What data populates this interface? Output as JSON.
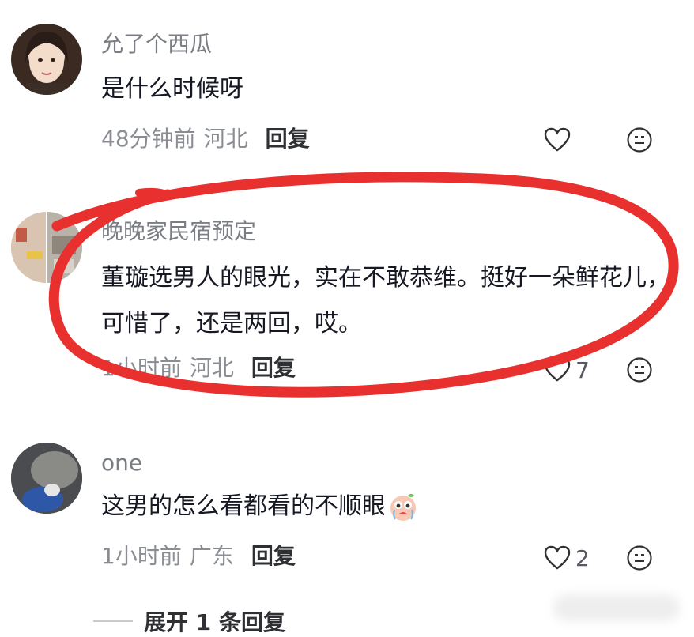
{
  "comments": [
    {
      "username": "允了个西瓜",
      "text": "是什么时候呀",
      "time": "48分钟前",
      "location": "河北",
      "reply_label": "回复",
      "like_count": ""
    },
    {
      "username": "晚晚家民宿预定",
      "text": "董璇选男人的眼光，实在不敢恭维。挺好一朵鲜花儿，可惜了，还是两回，哎。",
      "time": "1小时前",
      "location": "河北",
      "reply_label": "回复",
      "like_count": "7"
    },
    {
      "username": "one",
      "text": "这男的怎么看都看的不顺眼",
      "time": "1小时前",
      "location": "广东",
      "reply_label": "回复",
      "like_count": "2"
    }
  ],
  "expand": {
    "label": "展开 1 条回复"
  },
  "colors": {
    "annotation": "#e8302f",
    "username": "#7a7d84",
    "meta": "#8a8d93"
  },
  "icons": [
    "heart-icon",
    "emoji-icon",
    "crying-emoji-sticker"
  ]
}
